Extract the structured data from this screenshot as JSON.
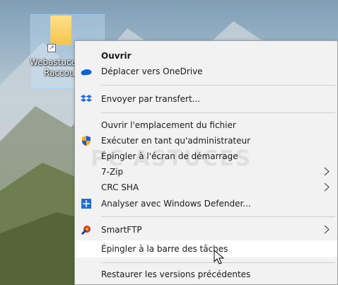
{
  "desktop": {
    "icon_label_line1": "Webastuces",
    "icon_label_line2": "Raccourci",
    "accent": "#99d1ff"
  },
  "menu": {
    "items": [
      {
        "id": "ouvrir",
        "label": "Ouvrir",
        "underline": "O",
        "bold": true
      },
      {
        "id": "onedrive",
        "label": "Déplacer vers OneDrive",
        "underline": "D",
        "icon": "onedrive-icon"
      },
      {
        "id": "transfert",
        "label": "Envoyer par transfert...",
        "icon": "dropbox-transfer-icon"
      },
      {
        "id": "emplacement",
        "label": "Ouvrir l'emplacement du fichier",
        "underline": "v"
      },
      {
        "id": "admin",
        "label": "Exécuter en tant qu'administrateur",
        "underline": "a",
        "icon": "uac-shield-icon"
      },
      {
        "id": "epingler-demarrage",
        "label": "Épingler à l'écran de démarrage",
        "underline": "p"
      },
      {
        "id": "7zip",
        "label": "7-Zip",
        "submenu": true
      },
      {
        "id": "crc",
        "label": "CRC SHA",
        "submenu": true
      },
      {
        "id": "defender",
        "label": "Analyser avec Windows Defender...",
        "icon": "windows-defender-icon"
      },
      {
        "id": "smartftp",
        "label": "SmartFTP",
        "submenu": true,
        "icon": "smartftp-icon"
      },
      {
        "id": "barre-taches",
        "label": "Épingler à la barre des tâches",
        "underline": "b",
        "hovered": true
      },
      {
        "id": "restaurer",
        "label": "Restaurer les versions précédentes",
        "underline": "é"
      }
    ]
  },
  "watermark": "PC ASTUCES"
}
